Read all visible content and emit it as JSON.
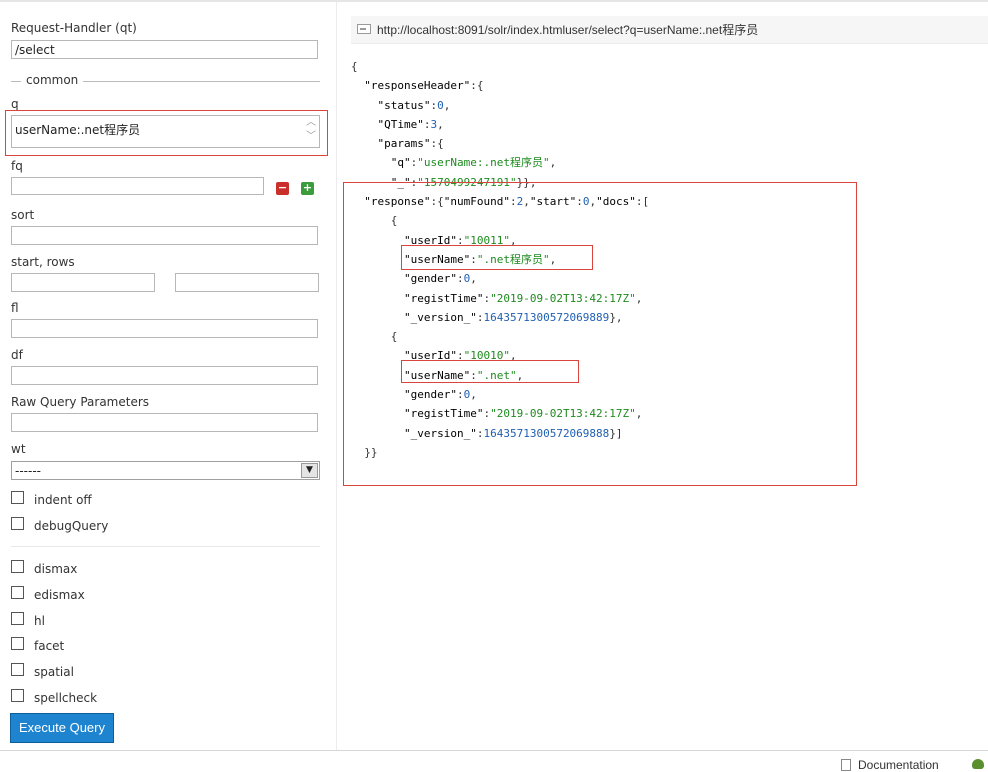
{
  "sidebar": {
    "request_handler_label": "Request-Handler (qt)",
    "request_handler_value": "/select",
    "common_legend": "common",
    "q_label": "q",
    "q_value": "userName:.net程序员",
    "fq_label": "fq",
    "sort_label": "sort",
    "start_rows_label": "start, rows",
    "fl_label": "fl",
    "df_label": "df",
    "raw_label": "Raw Query Parameters",
    "wt_label": "wt",
    "wt_value": "------",
    "checkboxes_top": [
      {
        "label": "indent off"
      },
      {
        "label": "debugQuery"
      }
    ],
    "checkboxes_bottom": [
      {
        "label": "dismax"
      },
      {
        "label": "edismax"
      },
      {
        "label": "hl"
      },
      {
        "label": "facet"
      },
      {
        "label": "spatial"
      },
      {
        "label": "spellcheck"
      }
    ],
    "execute_label": "Execute Query"
  },
  "result": {
    "url": "http://localhost:8091/solr/index.htmluser/select?q=userName:.net程序员",
    "responseHeader": {
      "status": "0",
      "QTime": "3",
      "q": "\"userName:.net程序员\"",
      "_": "\"1570499247191\""
    },
    "response": {
      "numFound": "2",
      "start": "0"
    },
    "docs": [
      {
        "userId": "\"10011\"",
        "userName": "\".net程序员\"",
        "gender": "0",
        "registTime": "\"2019-09-02T13:42:17Z\"",
        "version": "1643571300572069889"
      },
      {
        "userId": "\"10010\"",
        "userName": "\".net\"",
        "gender": "0",
        "registTime": "\"2019-09-02T13:42:17Z\"",
        "version": "1643571300572069888"
      }
    ]
  },
  "footer": {
    "documentation": "Documentation"
  },
  "colors": {
    "accent_button": "#1f84d0",
    "highlight_border": "#d9453c",
    "json_string": "#1d8a1d",
    "json_number": "#1f5fb2"
  }
}
